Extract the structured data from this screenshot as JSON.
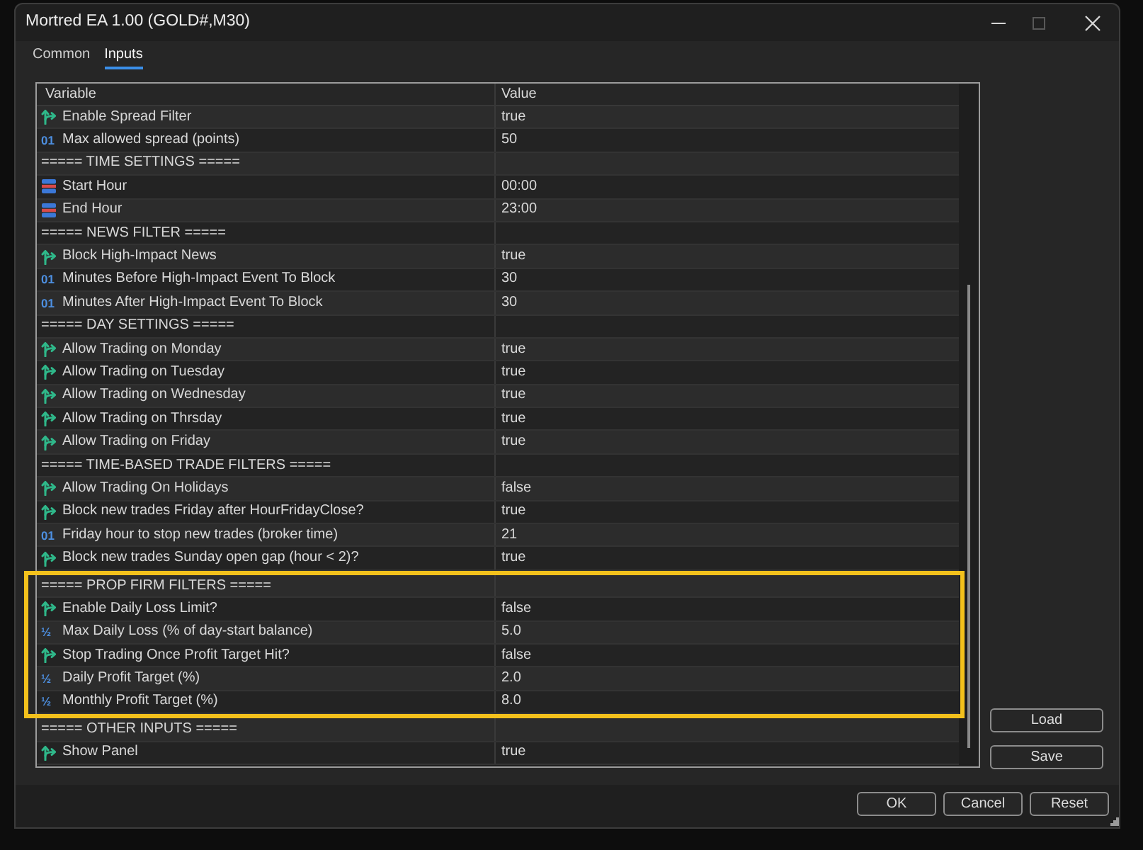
{
  "window": {
    "title": "Mortred EA 1.00 (GOLD#,M30)",
    "controls": [
      {
        "kind": "minimize",
        "disabled": false
      },
      {
        "kind": "maximize",
        "disabled": true
      },
      {
        "kind": "close",
        "disabled": false
      }
    ]
  },
  "tabs": [
    {
      "label": "Common",
      "selected": false
    },
    {
      "label": "Inputs",
      "selected": true
    }
  ],
  "table": {
    "columns": [
      "Variable",
      "Value"
    ],
    "rows": [
      {
        "kind": "bool",
        "variable": "Enable Spread Filter",
        "value": "true",
        "highlighted": false
      },
      {
        "kind": "int",
        "type_glyph": "01",
        "variable": "Max allowed spread (points)",
        "value": "50",
        "highlighted": false
      },
      {
        "kind": "section",
        "variable": "===== TIME SETTINGS =====",
        "highlighted": false
      },
      {
        "kind": "time",
        "variable": "Start Hour",
        "value": "00:00",
        "highlighted": false
      },
      {
        "kind": "time",
        "variable": "End Hour",
        "value": "23:00",
        "highlighted": false
      },
      {
        "kind": "section",
        "variable": "===== NEWS FILTER =====",
        "highlighted": false
      },
      {
        "kind": "bool",
        "variable": "Block High-Impact News",
        "value": "true",
        "highlighted": false
      },
      {
        "kind": "int",
        "type_glyph": "01",
        "variable": "Minutes Before High-Impact Event To Block",
        "value": "30",
        "highlighted": false
      },
      {
        "kind": "int",
        "type_glyph": "01",
        "variable": "Minutes After High-Impact Event To Block",
        "value": "30",
        "highlighted": false
      },
      {
        "kind": "section",
        "variable": "===== DAY SETTINGS =====",
        "highlighted": false
      },
      {
        "kind": "bool",
        "variable": "Allow Trading on Monday",
        "value": "true",
        "highlighted": false
      },
      {
        "kind": "bool",
        "variable": "Allow Trading on Tuesday",
        "value": "true",
        "highlighted": false
      },
      {
        "kind": "bool",
        "variable": "Allow Trading on Wednesday",
        "value": "true",
        "highlighted": false
      },
      {
        "kind": "bool",
        "variable": "Allow Trading on Thrsday",
        "value": "true",
        "highlighted": false
      },
      {
        "kind": "bool",
        "variable": "Allow Trading on Friday",
        "value": "true",
        "highlighted": false
      },
      {
        "kind": "section",
        "variable": "===== TIME-BASED TRADE FILTERS =====",
        "highlighted": false
      },
      {
        "kind": "bool",
        "variable": "Allow Trading On Holidays",
        "value": "false",
        "highlighted": false
      },
      {
        "kind": "bool",
        "variable": "Block new trades Friday after HourFridayClose?",
        "value": "true",
        "highlighted": false
      },
      {
        "kind": "int",
        "type_glyph": "01",
        "variable": "Friday hour to stop new trades (broker time)",
        "value": "21",
        "highlighted": false
      },
      {
        "kind": "bool",
        "variable": "Block new trades Sunday open gap (hour < 2)?",
        "value": "true",
        "highlighted": false
      },
      {
        "kind": "section",
        "variable": "===== PROP FIRM FILTERS =====",
        "highlighted": true
      },
      {
        "kind": "bool",
        "variable": "Enable Daily Loss Limit?",
        "value": "false",
        "highlighted": true
      },
      {
        "kind": "double",
        "type_glyph": "½",
        "variable": "Max Daily Loss (% of day-start balance)",
        "value": "5.0",
        "highlighted": true
      },
      {
        "kind": "bool",
        "variable": "Stop Trading Once Profit Target Hit?",
        "value": "false",
        "highlighted": true
      },
      {
        "kind": "double",
        "type_glyph": "½",
        "variable": "Daily Profit Target (%)",
        "value": "2.0",
        "highlighted": true
      },
      {
        "kind": "double",
        "type_glyph": "½",
        "variable": "Monthly Profit Target (%)",
        "value": "8.0",
        "highlighted": true
      },
      {
        "kind": "section",
        "variable": "===== OTHER INPUTS =====",
        "highlighted": false
      },
      {
        "kind": "bool",
        "variable": "Show Panel",
        "value": "true",
        "highlighted": false
      }
    ]
  },
  "side_buttons": [
    "Load",
    "Save"
  ],
  "buttons": [
    "OK",
    "Cancel",
    "Reset"
  ]
}
